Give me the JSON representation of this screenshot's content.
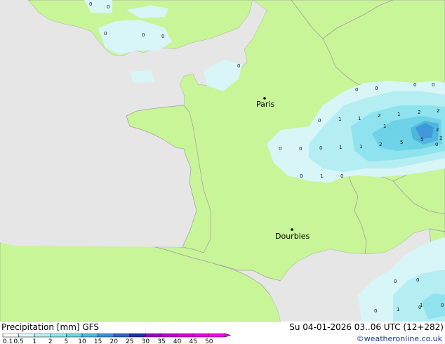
{
  "map": {
    "cities": [
      {
        "name": "Paris"
      },
      {
        "name": "Dourbies"
      }
    ],
    "precip_values": [
      "0",
      "0",
      "0",
      "0",
      "0",
      "0",
      "0",
      "0",
      "0",
      "0",
      "0",
      "0",
      "0",
      "1",
      "1",
      "1",
      "2",
      "1",
      "2",
      "2",
      "0",
      "1",
      "1",
      "2",
      "0",
      "1",
      "0",
      "0",
      "0",
      "0",
      "1",
      "0",
      "1",
      "0",
      "2",
      "5",
      "5",
      "2",
      "0"
    ]
  },
  "footer": {
    "title": "Precipitation [mm] GFS",
    "datetime": "Su 04-01-2026 03..06 UTC (12+282)",
    "credit": "©weatheronline.co.uk"
  },
  "legend": {
    "ticks": [
      "0.1",
      "0.5",
      "1",
      "2",
      "5",
      "10",
      "15",
      "20",
      "25",
      "30",
      "35",
      "40",
      "45",
      "50"
    ],
    "colors": [
      "#ffffff",
      "#d8f5f8",
      "#b4eef3",
      "#8fe3ee",
      "#6ed3e6",
      "#4fb6df",
      "#3a8fd6",
      "#2d5fc7",
      "#1f2fa8",
      "#9a00c8",
      "#c000d8",
      "#d800d8",
      "#e800e0",
      "#f300f0"
    ]
  }
}
